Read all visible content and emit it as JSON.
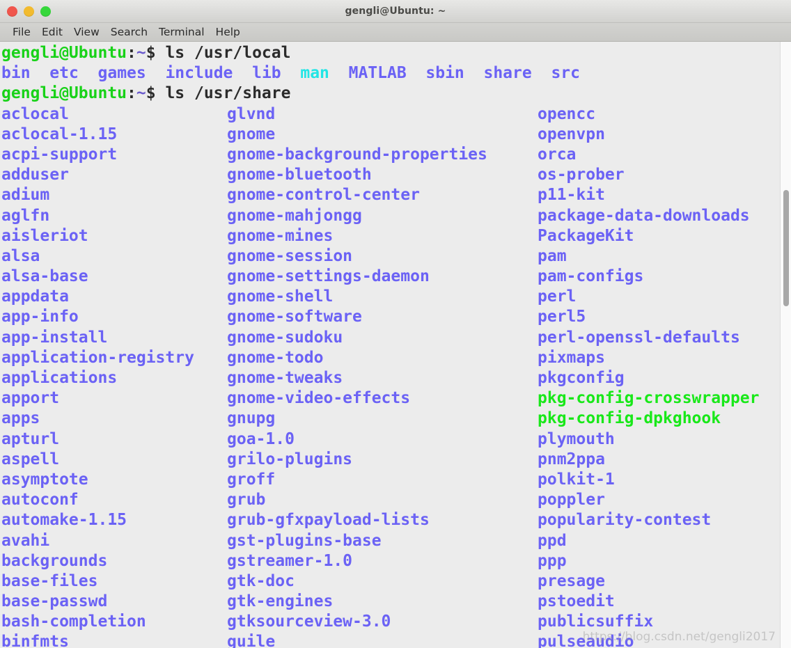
{
  "window": {
    "title": "gengli@Ubuntu: ~",
    "controls": [
      {
        "name": "close",
        "color": "#f0564d"
      },
      {
        "name": "minimize",
        "color": "#f2bb2f"
      },
      {
        "name": "maximize",
        "color": "#36d73b"
      }
    ]
  },
  "menubar": {
    "items": [
      {
        "label": "File"
      },
      {
        "label": "Edit"
      },
      {
        "label": "View"
      },
      {
        "label": "Search"
      },
      {
        "label": "Terminal"
      },
      {
        "label": "Help"
      }
    ]
  },
  "colors": {
    "background": "#ececec",
    "directory": "#6b62f5",
    "executable": "#19e819",
    "symlink": "#22e5e5",
    "prompt_user": "#18d218",
    "prompt_punct": "#2b2b2b",
    "prompt_tilde": "#6a5acd",
    "scrollbar_thumb": "#a8a8a8"
  },
  "terminal": {
    "prompt": {
      "user_host": "gengli@Ubuntu",
      "colon": ":",
      "tilde": "~",
      "dollar": "$"
    },
    "command_1": " ls /usr/local",
    "command_2": " ls /usr/share",
    "local_listing": [
      {
        "name": "bin",
        "type": "dir"
      },
      {
        "name": "etc",
        "type": "dir"
      },
      {
        "name": "games",
        "type": "dir"
      },
      {
        "name": "include",
        "type": "dir"
      },
      {
        "name": "lib",
        "type": "dir"
      },
      {
        "name": "man",
        "type": "link"
      },
      {
        "name": "MATLAB",
        "type": "dir"
      },
      {
        "name": "sbin",
        "type": "dir"
      },
      {
        "name": "share",
        "type": "dir"
      },
      {
        "name": "src",
        "type": "dir"
      }
    ],
    "local_listing_line": "bin  etc  games  include  lib  man  MATLAB  sbin  share  src",
    "share_listing_columns": [
      [
        {
          "name": "aclocal",
          "type": "dir"
        },
        {
          "name": "aclocal-1.15",
          "type": "dir"
        },
        {
          "name": "acpi-support",
          "type": "dir"
        },
        {
          "name": "adduser",
          "type": "dir"
        },
        {
          "name": "adium",
          "type": "dir"
        },
        {
          "name": "aglfn",
          "type": "dir"
        },
        {
          "name": "aisleriot",
          "type": "dir"
        },
        {
          "name": "alsa",
          "type": "dir"
        },
        {
          "name": "alsa-base",
          "type": "dir"
        },
        {
          "name": "appdata",
          "type": "dir"
        },
        {
          "name": "app-info",
          "type": "dir"
        },
        {
          "name": "app-install",
          "type": "dir"
        },
        {
          "name": "application-registry",
          "type": "dir"
        },
        {
          "name": "applications",
          "type": "dir"
        },
        {
          "name": "apport",
          "type": "dir"
        },
        {
          "name": "apps",
          "type": "dir"
        },
        {
          "name": "apturl",
          "type": "dir"
        },
        {
          "name": "aspell",
          "type": "dir"
        },
        {
          "name": "asymptote",
          "type": "dir"
        },
        {
          "name": "autoconf",
          "type": "dir"
        },
        {
          "name": "automake-1.15",
          "type": "dir"
        },
        {
          "name": "avahi",
          "type": "dir"
        },
        {
          "name": "backgrounds",
          "type": "dir"
        },
        {
          "name": "base-files",
          "type": "dir"
        },
        {
          "name": "base-passwd",
          "type": "dir"
        },
        {
          "name": "bash-completion",
          "type": "dir"
        },
        {
          "name": "binfmts",
          "type": "dir"
        }
      ],
      [
        {
          "name": "glvnd",
          "type": "dir"
        },
        {
          "name": "gnome",
          "type": "dir"
        },
        {
          "name": "gnome-background-properties",
          "type": "dir"
        },
        {
          "name": "gnome-bluetooth",
          "type": "dir"
        },
        {
          "name": "gnome-control-center",
          "type": "dir"
        },
        {
          "name": "gnome-mahjongg",
          "type": "dir"
        },
        {
          "name": "gnome-mines",
          "type": "dir"
        },
        {
          "name": "gnome-session",
          "type": "dir"
        },
        {
          "name": "gnome-settings-daemon",
          "type": "dir"
        },
        {
          "name": "gnome-shell",
          "type": "dir"
        },
        {
          "name": "gnome-software",
          "type": "dir"
        },
        {
          "name": "gnome-sudoku",
          "type": "dir"
        },
        {
          "name": "gnome-todo",
          "type": "dir"
        },
        {
          "name": "gnome-tweaks",
          "type": "dir"
        },
        {
          "name": "gnome-video-effects",
          "type": "dir"
        },
        {
          "name": "gnupg",
          "type": "dir"
        },
        {
          "name": "goa-1.0",
          "type": "dir"
        },
        {
          "name": "grilo-plugins",
          "type": "dir"
        },
        {
          "name": "groff",
          "type": "dir"
        },
        {
          "name": "grub",
          "type": "dir"
        },
        {
          "name": "grub-gfxpayload-lists",
          "type": "dir"
        },
        {
          "name": "gst-plugins-base",
          "type": "dir"
        },
        {
          "name": "gstreamer-1.0",
          "type": "dir"
        },
        {
          "name": "gtk-doc",
          "type": "dir"
        },
        {
          "name": "gtk-engines",
          "type": "dir"
        },
        {
          "name": "gtksourceview-3.0",
          "type": "dir"
        },
        {
          "name": "guile",
          "type": "dir"
        }
      ],
      [
        {
          "name": "opencc",
          "type": "dir"
        },
        {
          "name": "openvpn",
          "type": "dir"
        },
        {
          "name": "orca",
          "type": "dir"
        },
        {
          "name": "os-prober",
          "type": "dir"
        },
        {
          "name": "p11-kit",
          "type": "dir"
        },
        {
          "name": "package-data-downloads",
          "type": "dir"
        },
        {
          "name": "PackageKit",
          "type": "dir"
        },
        {
          "name": "pam",
          "type": "dir"
        },
        {
          "name": "pam-configs",
          "type": "dir"
        },
        {
          "name": "perl",
          "type": "dir"
        },
        {
          "name": "perl5",
          "type": "dir"
        },
        {
          "name": "perl-openssl-defaults",
          "type": "dir"
        },
        {
          "name": "pixmaps",
          "type": "dir"
        },
        {
          "name": "pkgconfig",
          "type": "dir"
        },
        {
          "name": "pkg-config-crosswrapper",
          "type": "exec"
        },
        {
          "name": "pkg-config-dpkghook",
          "type": "exec"
        },
        {
          "name": "plymouth",
          "type": "dir"
        },
        {
          "name": "pnm2ppa",
          "type": "dir"
        },
        {
          "name": "polkit-1",
          "type": "dir"
        },
        {
          "name": "poppler",
          "type": "dir"
        },
        {
          "name": "popularity-contest",
          "type": "dir"
        },
        {
          "name": "ppd",
          "type": "dir"
        },
        {
          "name": "ppp",
          "type": "dir"
        },
        {
          "name": "presage",
          "type": "dir"
        },
        {
          "name": "pstoedit",
          "type": "dir"
        },
        {
          "name": "publicsuffix",
          "type": "dir"
        },
        {
          "name": "pulseaudio",
          "type": "dir"
        }
      ]
    ]
  },
  "watermark": {
    "text": "https://blog.csdn.net/gengli2017"
  }
}
